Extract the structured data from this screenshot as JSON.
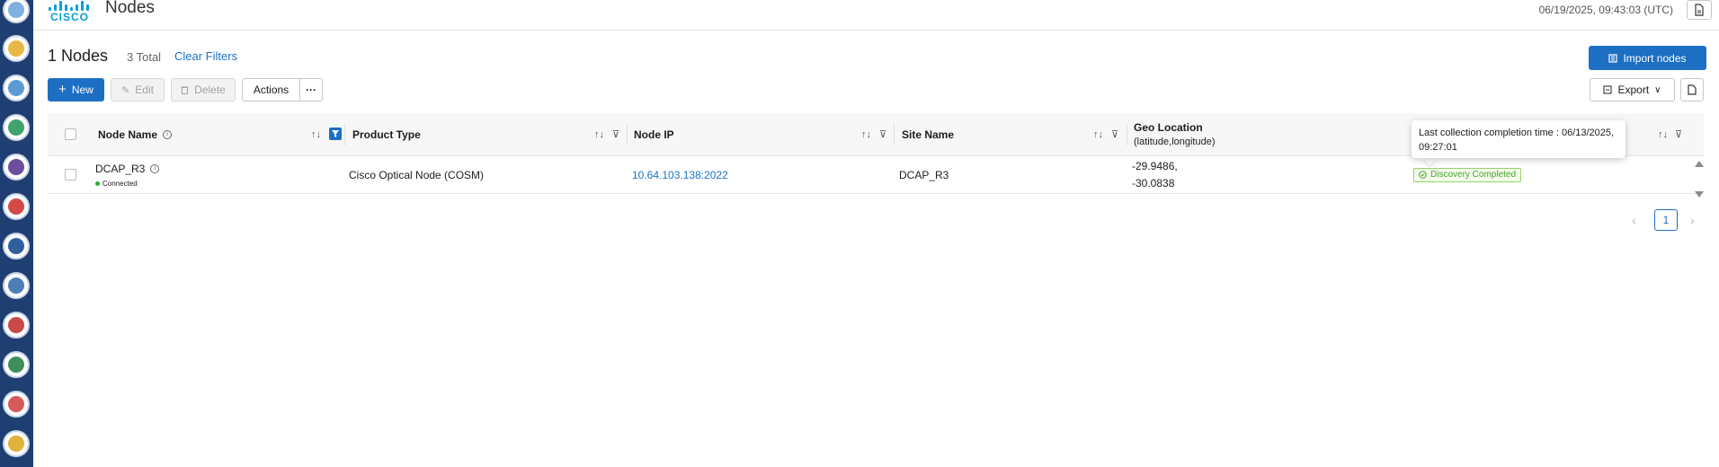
{
  "header": {
    "logo_text": "CISCO",
    "title": "Nodes",
    "timestamp": "06/19/2025, 09:43:03 (UTC)"
  },
  "rail": {
    "icons": [
      "network-icon",
      "topology-icon",
      "inventory-icon",
      "documents-icon",
      "monitoring-icon",
      "performance-icon",
      "dashboard-icon",
      "settings-icon",
      "alarms-icon",
      "global-icon",
      "troubleshoot-icon",
      "database-icon"
    ]
  },
  "summary": {
    "count_label": "1 Nodes",
    "total_label": "3 Total",
    "clear_filters": "Clear Filters",
    "import_label": "Import nodes"
  },
  "toolbar": {
    "new_label": "New",
    "edit_label": "Edit",
    "delete_label": "Delete",
    "actions_label": "Actions",
    "more_label": "···",
    "export_label": "Export"
  },
  "table": {
    "columns": {
      "node_name": "Node Name",
      "product_type": "Product Type",
      "node_ip": "Node IP",
      "site_name": "Site Name",
      "geo_location": "Geo Location",
      "geo_location_sub": "(latitude,longitude)"
    },
    "rows": [
      {
        "node_name": "DCAP_R3",
        "status": "Connected",
        "product_type": "Cisco Optical Node (COSM)",
        "node_ip": "10.64.103.138:2022",
        "site_name": "DCAP_R3",
        "latitude": "-29.9486,",
        "longitude": "-30.0838",
        "discovery": "Discovery Completed"
      }
    ]
  },
  "tooltip": {
    "line1": "Last collection completion time : 06/13/2025,",
    "line2": "09:27:01"
  },
  "pagination": {
    "current_page": "1"
  },
  "colors": {
    "accent": "#1c6fc3",
    "rail": "#1f3f73",
    "success": "#4aa52e"
  }
}
